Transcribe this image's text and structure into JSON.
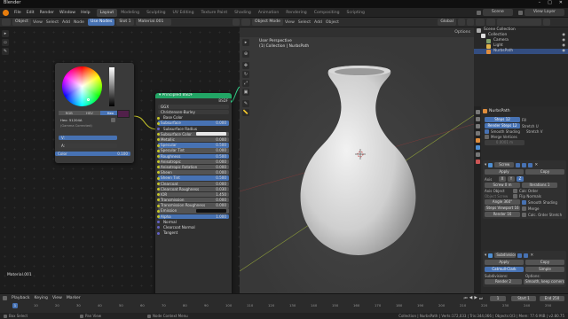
{
  "app_title": "Blender",
  "menu": [
    "File",
    "Edit",
    "Render",
    "Window",
    "Help"
  ],
  "workspaces": [
    "Layout",
    "Modeling",
    "Sculpting",
    "UV Editing",
    "Texture Paint",
    "Shading",
    "Animation",
    "Rendering",
    "Compositing",
    "Scripting"
  ],
  "active_workspace": "Layout",
  "scene": "Scene",
  "view_layer": "View Layer",
  "node_header": {
    "editor": "Object",
    "view": "View",
    "select": "Select",
    "add": "Add",
    "node": "Node",
    "use_nodes": "Use Nodes",
    "slot": "Slot 1",
    "material": "Material.001"
  },
  "color_picker": {
    "modes": [
      "RGB",
      "HSV",
      "Hex"
    ],
    "active_mode": "Hex",
    "hex": "Hex: 51204A",
    "gamma": "(Gamma Corrected)",
    "value_label": "V:",
    "alpha_label": "A:",
    "alpha_value": "1.000",
    "output": "Color",
    "output_value": "0.100"
  },
  "bsdf": {
    "title": "Principled BSDF",
    "output": "BSDF",
    "rows": [
      {
        "label": "GGX",
        "type": "select"
      },
      {
        "label": "Christensen-Burley",
        "type": "select"
      },
      {
        "label": "Base Color",
        "type": "plain"
      },
      {
        "label": "Subsurface",
        "value": "0.000",
        "type": "blue"
      },
      {
        "label": "Subsurface Radius",
        "type": "plain"
      },
      {
        "label": "Subsurface Color",
        "type": "color"
      },
      {
        "label": "Metallic",
        "value": "0.000",
        "type": "grey"
      },
      {
        "label": "Specular",
        "value": "0.500",
        "type": "blue"
      },
      {
        "label": "Specular Tint",
        "value": "0.000",
        "type": "grey"
      },
      {
        "label": "Roughness",
        "value": "0.500",
        "type": "blue"
      },
      {
        "label": "Anisotropic",
        "value": "0.000",
        "type": "grey"
      },
      {
        "label": "Anisotropic Rotation",
        "value": "0.000",
        "type": "grey"
      },
      {
        "label": "Sheen",
        "value": "0.000",
        "type": "grey"
      },
      {
        "label": "Sheen Tint",
        "value": "0.500",
        "type": "blue"
      },
      {
        "label": "Clearcoat",
        "value": "0.000",
        "type": "grey"
      },
      {
        "label": "Clearcoat Roughness",
        "value": "0.030",
        "type": "grey"
      },
      {
        "label": "IOR",
        "value": "1.450",
        "type": "grey"
      },
      {
        "label": "Transmission",
        "value": "0.000",
        "type": "grey"
      },
      {
        "label": "Transmission Roughness",
        "value": "0.000",
        "type": "grey"
      },
      {
        "label": "Emission",
        "type": "emission"
      },
      {
        "label": "Alpha",
        "value": "1.000",
        "type": "blue"
      },
      {
        "label": "Normal",
        "type": "plain"
      },
      {
        "label": "Clearcoat Normal",
        "type": "plain"
      },
      {
        "label": "Tangent",
        "type": "plain"
      }
    ]
  },
  "node_editor_footer": "Material.001",
  "viewport": {
    "mode": "Object Mode",
    "view": "View",
    "select": "Select",
    "add": "Add",
    "object": "Object",
    "transform": "Global",
    "options": "Options",
    "info_line1": "User Perspective",
    "info_line2": "(1) Collection | NurbsPath"
  },
  "outliner": {
    "title": "Scene Collection",
    "items": [
      {
        "label": "Collection",
        "indent": 1
      },
      {
        "label": "Camera",
        "indent": 2
      },
      {
        "label": "Light",
        "indent": 2
      },
      {
        "label": "NurbsPath",
        "indent": 2
      }
    ]
  },
  "properties": {
    "object_name": "NurbsPath",
    "shape": {
      "steps_label": "Steps",
      "steps_value": "12",
      "render_steps_label": "Render Steps",
      "render_steps_value": "12",
      "smooth_shading": "Smooth Shading",
      "merge_vertices": "Merge Vertices",
      "merge_value": "0.0001 m",
      "fill": "Fill",
      "stretch": "Stretch U",
      "ultra": "Stretch V"
    },
    "screw": {
      "name": "Screw",
      "apply": "Apply",
      "copy": "Copy",
      "axis_label": "Axis",
      "axis_values": [
        "X",
        "Y",
        "Z"
      ],
      "screw_label": "Screw",
      "screw_value": "0 m",
      "iterations_label": "Iterations",
      "iterations_value": "1",
      "axis_object": "Axis Object",
      "object_screw": "Object Screw",
      "angle_label": "Angle",
      "angle_value": "360°",
      "calc_order": "Calc Order",
      "flip": "Flip Normals",
      "steps_view_label": "Steps Viewport",
      "steps_view_value": "16",
      "render_label": "Render",
      "render_value": "16",
      "merge": "Merge",
      "smooth": "Smooth Shading",
      "uv": "Calc. Order Stretch",
      "edit_mode": "Edit Mode",
      "normals": "Normals"
    },
    "subsurf": {
      "name": "Subdivision",
      "apply": "Apply",
      "copy": "Copy",
      "catmull": "Catmull-Clark",
      "simple": "Simple",
      "subdivisions": "Subdivisions:",
      "render_label": "Render",
      "render_value": "2",
      "viewport_label": "Viewport",
      "viewport_value": "1",
      "quality_label": "Quality",
      "quality_value": "3",
      "options": "Options:",
      "uv_smooth": "Smooth, keep corners",
      "optimal": "Optimal Display",
      "creases": "Use Creases"
    }
  },
  "timeline": {
    "menus": [
      "Playback",
      "Keying",
      "View",
      "Marker"
    ],
    "frame": "1",
    "start_label": "Start",
    "start": "1",
    "end_label": "End",
    "end": "250",
    "ticks": [
      "0",
      "10",
      "20",
      "30",
      "40",
      "50",
      "60",
      "70",
      "80",
      "90",
      "100",
      "110",
      "120",
      "130",
      "140",
      "150",
      "160",
      "170",
      "180",
      "190",
      "200",
      "210",
      "220",
      "230",
      "240",
      "250"
    ]
  },
  "status": {
    "left": "Box Select",
    "mid": "Pan View",
    "mid2": "Node Context Menu",
    "right": "Collection | NurbsPath | Verts:172,033 | Tris:344,066 | Objects:0/3 | Mem: 77.6 MiB | v2.80.75"
  },
  "colors": {
    "accent": "#4772b3",
    "bsdf_header": "#22a565",
    "base_color": "#51204a"
  }
}
